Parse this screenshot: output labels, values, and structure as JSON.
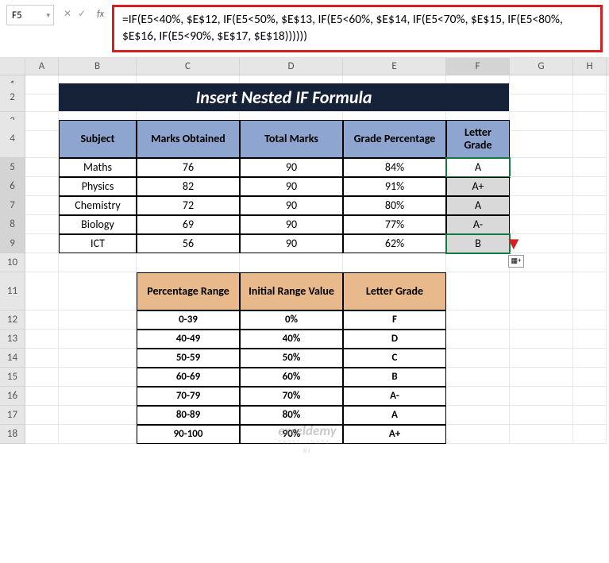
{
  "nameBox": "F5",
  "formula": "=IF(E5<40%, $E$12, IF(E5<50%, $E$13, IF(E5<60%, $E$14, IF(E5<70%, $E$15, IF(E5<80%, $E$16, IF(E5<90%, $E$17, $E$18))))))",
  "columns": [
    "",
    "A",
    "B",
    "C",
    "D",
    "E",
    "F",
    "G",
    "H"
  ],
  "title": "Insert Nested IF Formula",
  "headers": {
    "subject": "Subject",
    "marks": "Marks Obtained",
    "total": "Total Marks",
    "pct": "Grade Percentage",
    "letter": "Letter Grade"
  },
  "rows": [
    {
      "subject": "Maths",
      "marks": "76",
      "total": "90",
      "pct": "84%",
      "letter": "A"
    },
    {
      "subject": "Physics",
      "marks": "82",
      "total": "90",
      "pct": "91%",
      "letter": "A+"
    },
    {
      "subject": "Chemistry",
      "marks": "72",
      "total": "90",
      "pct": "80%",
      "letter": "A"
    },
    {
      "subject": "Biology",
      "marks": "69",
      "total": "90",
      "pct": "77%",
      "letter": "A-"
    },
    {
      "subject": "ICT",
      "marks": "56",
      "total": "90",
      "pct": "62%",
      "letter": "B"
    }
  ],
  "lookupHeaders": {
    "range": "Percentage Range",
    "initial": "Initial Range Value",
    "letter": "Letter Grade"
  },
  "lookup": [
    {
      "range": "0-39",
      "initial": "0%",
      "letter": "F"
    },
    {
      "range": "40-49",
      "initial": "40%",
      "letter": "D"
    },
    {
      "range": "50-59",
      "initial": "50%",
      "letter": "C"
    },
    {
      "range": "60-69",
      "initial": "60%",
      "letter": "B"
    },
    {
      "range": "70-79",
      "initial": "70%",
      "letter": "A-"
    },
    {
      "range": "80-89",
      "initial": "80%",
      "letter": "A"
    },
    {
      "range": "90-100",
      "initial": "90%",
      "letter": "A+"
    }
  ],
  "watermark": {
    "main": "exceldemy",
    "sub": "EXCEL · DATA · BI"
  },
  "icons": {
    "check": "✓",
    "x": "✕",
    "dropdown": "▾",
    "autofill": "▦+"
  },
  "chart_data": {
    "type": "table",
    "title": "Insert Nested IF Formula",
    "tables": [
      {
        "columns": [
          "Subject",
          "Marks Obtained",
          "Total Marks",
          "Grade Percentage",
          "Letter Grade"
        ],
        "rows": [
          [
            "Maths",
            76,
            90,
            "84%",
            "A"
          ],
          [
            "Physics",
            82,
            90,
            "91%",
            "A+"
          ],
          [
            "Chemistry",
            72,
            90,
            "80%",
            "A"
          ],
          [
            "Biology",
            69,
            90,
            "77%",
            "A-"
          ],
          [
            "ICT",
            56,
            90,
            "62%",
            "B"
          ]
        ]
      },
      {
        "columns": [
          "Percentage Range",
          "Initial Range Value",
          "Letter Grade"
        ],
        "rows": [
          [
            "0-39",
            "0%",
            "F"
          ],
          [
            "40-49",
            "40%",
            "D"
          ],
          [
            "50-59",
            "50%",
            "C"
          ],
          [
            "60-69",
            "60%",
            "B"
          ],
          [
            "70-79",
            "70%",
            "A-"
          ],
          [
            "80-89",
            "80%",
            "A"
          ],
          [
            "90-100",
            "90%",
            "A+"
          ]
        ]
      }
    ]
  }
}
